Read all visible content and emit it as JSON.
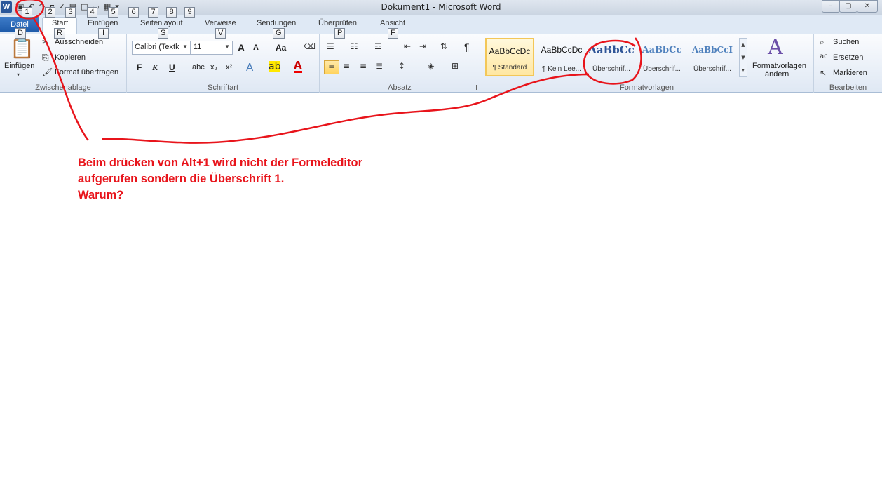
{
  "window": {
    "title": "Dokument1  -  Microsoft Word",
    "app_icon": "W",
    "qat_icons": [
      "save-icon",
      "undo-icon",
      "redo-icon",
      "equation-icon",
      "abc-icon",
      "print-icon",
      "new-icon",
      "open-icon",
      "quickprint-icon"
    ],
    "buttons": [
      "minimize-icon",
      "maximize-icon",
      "close-icon"
    ]
  },
  "keytips": {
    "qat": [
      "1",
      "2",
      "3",
      "4",
      "5",
      "6",
      "7",
      "8",
      "9"
    ],
    "datei": "D",
    "start": "R",
    "einfuegen": "I",
    "seitenlayout": "S",
    "verweise": "V",
    "sendungen": "G",
    "ueberpruefen": "P",
    "ansicht": "F"
  },
  "tabs": {
    "datei": "Datei",
    "start": "Start",
    "einfuegen": "Einfügen",
    "seitenlayout": "Seitenlayout",
    "verweise": "Verweise",
    "sendungen": "Sendungen",
    "ueberpruefen": "Überprüfen",
    "ansicht": "Ansicht"
  },
  "clipboard": {
    "label": "Zwischenablage",
    "paste": "Einfügen",
    "cut": "Ausschneiden",
    "copy": "Kopieren",
    "format_painter": "Format übertragen"
  },
  "font": {
    "label": "Schriftart",
    "family": "Calibri (Textk",
    "size": "11",
    "bold": "F",
    "italic": "K",
    "underline": "U",
    "strike": "abc",
    "subscript": "x₂",
    "superscript": "x²",
    "grow": "A",
    "shrink": "A",
    "case": "Aa"
  },
  "paragraph": {
    "label": "Absatz",
    "pilcrow": "¶"
  },
  "styles": {
    "label": "Formatvorlagen",
    "items": [
      {
        "preview": "AaBbCcDc",
        "name": "¶ Standard"
      },
      {
        "preview": "AaBbCcDc",
        "name": "¶ Kein Lee..."
      },
      {
        "preview": "AaBbCc",
        "name": "Überschrif..."
      },
      {
        "preview": "AaBbCc",
        "name": "Überschrif..."
      },
      {
        "preview": "AaBbCcI",
        "name": "Überschrif..."
      }
    ],
    "change_line1": "Formatvorlagen",
    "change_line2": "ändern"
  },
  "editing": {
    "label": "Bearbeiten",
    "find": "Suchen",
    "replace": "Ersetzen",
    "select": "Markieren"
  },
  "annotation": {
    "line1": "Beim drücken von Alt+1 wird nicht der Formeleditor",
    "line2": "aufgerufen sondern die Überschrift 1.",
    "line3": "Warum?",
    "color": "#e8141b"
  }
}
